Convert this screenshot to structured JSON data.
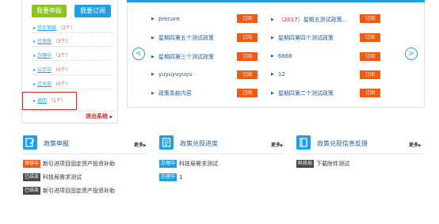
{
  "left_panel": {
    "apply_button": "我要申报",
    "subscribe_button": "我要订阅",
    "status_items": [
      {
        "label": "正在审核",
        "count": "（2个）"
      },
      {
        "label": "已审核",
        "count": "（3个）"
      },
      {
        "label": "办理中",
        "count": "（2个）"
      },
      {
        "label": "公示中",
        "count": "（0个）"
      },
      {
        "label": "已兑现",
        "count": "（0个）"
      },
      {
        "label": "退回",
        "count": "（1个）"
      }
    ],
    "logout": "退出系统"
  },
  "policy_list": {
    "subscribe_label": "订阅",
    "left_column": [
      "precure",
      "星期四第五个测试政策",
      "星期四第三个测试政策",
      "yuyuyuyuyu",
      "政策条款内容"
    ],
    "right_column": [
      {
        "prefix": "（2017）",
        "text": "星期五测试政策..."
      },
      {
        "prefix": "",
        "text": "星期四第四个测试政策"
      },
      {
        "prefix": "",
        "text": "6666"
      },
      {
        "prefix": "",
        "text": "12"
      },
      {
        "prefix": "",
        "text": "星期四第二个测试政策"
      }
    ]
  },
  "sections": {
    "more_label": "更多",
    "declare": {
      "title": "政策申报",
      "rows": [
        {
          "badge": "审核中",
          "badge_color": "#ef5a14",
          "text": "新引进项目固定资产投资补助"
        },
        {
          "badge": "已结束",
          "badge_color": "#4a4a4a",
          "text": "科技局需求测试"
        },
        {
          "badge": "已结束",
          "badge_color": "#4a4a4a",
          "text": "新引进项目固定资产投资补助"
        }
      ]
    },
    "progress": {
      "title": "政策兑现进度",
      "rows": [
        {
          "badge": "办理中",
          "badge_color": "#1fa0e6",
          "text": "科技局需求测试"
        },
        {
          "badge": "办理中",
          "badge_color": "#1fa0e6",
          "text": "1"
        }
      ]
    },
    "feedback": {
      "title": "政策兑现信息反馈",
      "rows": [
        {
          "badge": "科技局",
          "badge_color": "#4a4a4a",
          "text": "下载附件测试"
        }
      ]
    }
  },
  "colors": {
    "accent": "#1fa0e6",
    "green": "#8dc21f",
    "orange": "#ef5a14",
    "red": "#e02222"
  }
}
